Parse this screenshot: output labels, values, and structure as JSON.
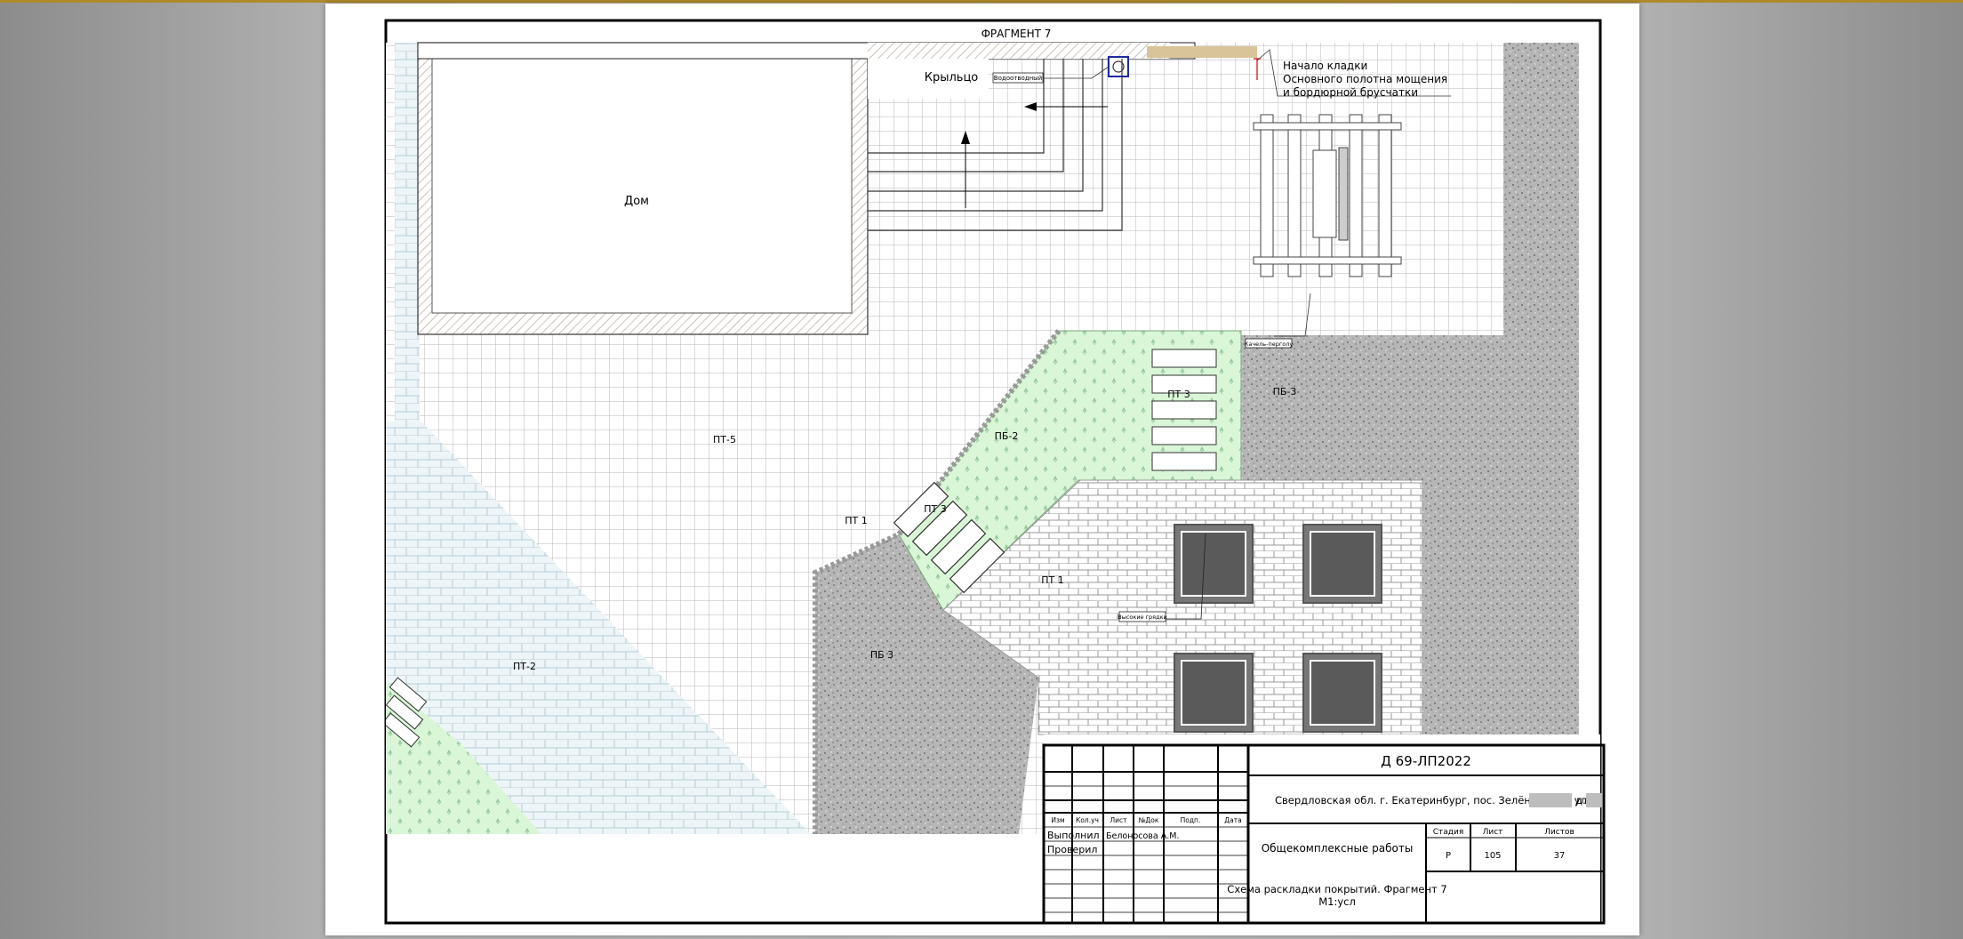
{
  "header": {
    "fragment_title": "ФРАГМЕНТ 7"
  },
  "plan": {
    "house_label": "Дом",
    "porch_label": "Крыльцо",
    "porch_tag": "Водоотводный",
    "masonry_note": [
      "Начало кладки",
      "Основного полотна мощения",
      "и бордюрной брусчатки"
    ],
    "pergola_tag": "Качель-перголу",
    "pit_tag": "Высокие грядки",
    "zones": {
      "pt5": "ПТ-5",
      "pt2": "ПТ-2",
      "pb2": "ПБ-2",
      "pb3_right": "ПБ-3",
      "pb3_left": "ПБ 3",
      "pt3_upper": "ПТ 3",
      "pt3_lower": "ПТ 3",
      "pt1_edge": "ПТ 1",
      "pt1_center": "ПТ 1"
    }
  },
  "title_block": {
    "doc_code": "Д 69-ЛП2022",
    "address": "Свердловская обл. г. Екатеринбург, пос. Зелёный бор, ул.",
    "address_house_prefix": "д.",
    "headers": [
      "Изм",
      "Кол.уч",
      "Лист",
      "№Док",
      "Подп.",
      "Дата"
    ],
    "roles": [
      "Выполнил",
      "Проверил"
    ],
    "author": "Белоносова А.М.",
    "work_type": "Общекомплексные работы",
    "stage_label": "Стадия",
    "sheet_label": "Лист",
    "sheets_label": "Листов",
    "stage_value": "Р",
    "sheet_value": "105",
    "sheets_value": "37",
    "drawing_title_line1": "Схема раскладки покрытий. Фрагмент 7",
    "drawing_title_line2": "М1:усл"
  }
}
